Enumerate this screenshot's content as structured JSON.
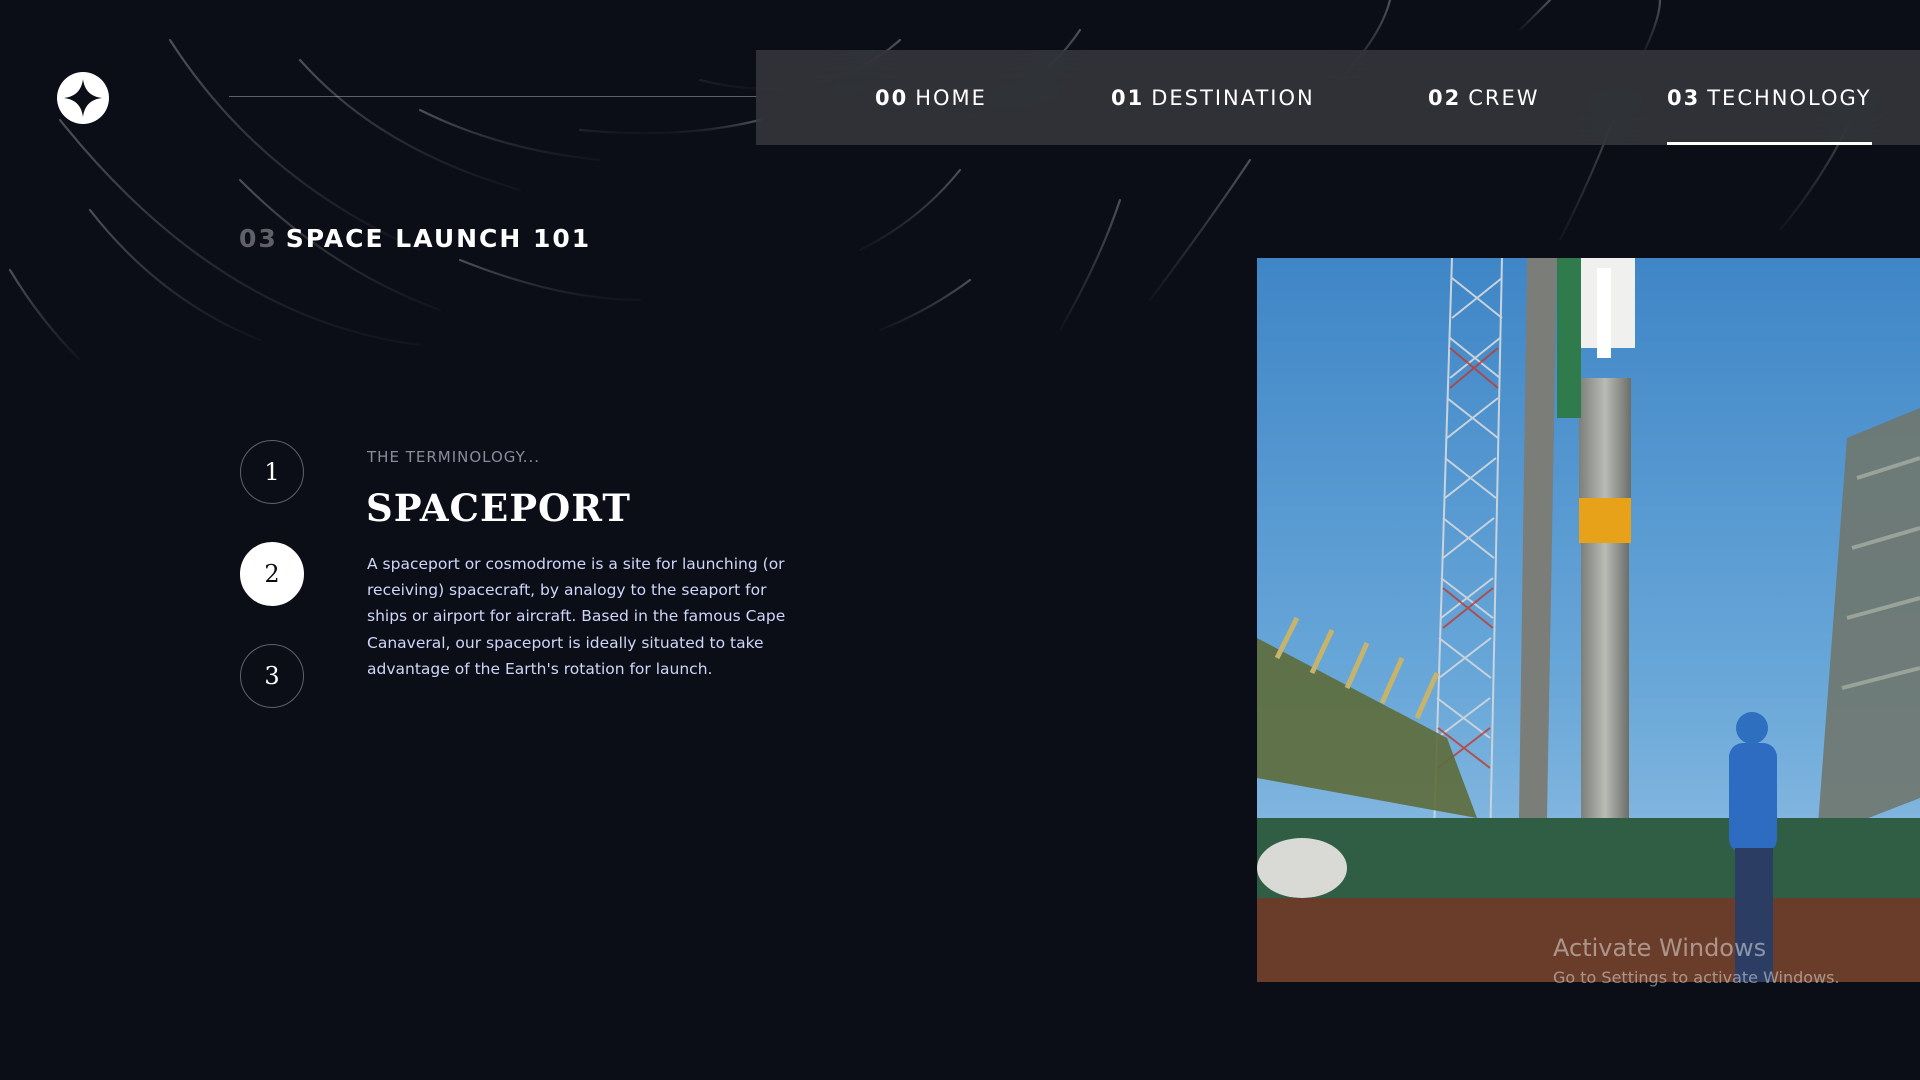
{
  "nav": {
    "items": [
      {
        "num": "00",
        "label": "HOME"
      },
      {
        "num": "01",
        "label": "DESTINATION"
      },
      {
        "num": "02",
        "label": "CREW"
      },
      {
        "num": "03",
        "label": "TECHNOLOGY"
      }
    ],
    "active": "TECHNOLOGY"
  },
  "page": {
    "heading_num": "03",
    "heading_label": "SPACE LAUNCH 101"
  },
  "steps": {
    "items": [
      "1",
      "2",
      "3"
    ],
    "active": "2"
  },
  "content": {
    "eyebrow": "THE TERMINOLOGY...",
    "title": "SPACEPORT",
    "description": "A spaceport or cosmodrome is a site for launching (or receiving) spacecraft, by analogy to the seaport for ships or airport for aircraft. Based in the famous Cape Canaveral, our spaceport is ideally situated to take advantage of the Earth's rotation for launch."
  },
  "watermark": {
    "title": "Activate Windows",
    "subtitle": "Go to Settings to activate Windows."
  },
  "colors": {
    "background": "#0b0d17",
    "nav_bg": "#3a3c40",
    "accent": "#ffffff",
    "body_text": "#d0d6f9"
  },
  "icons": {
    "logo": "four-point-star-icon"
  }
}
